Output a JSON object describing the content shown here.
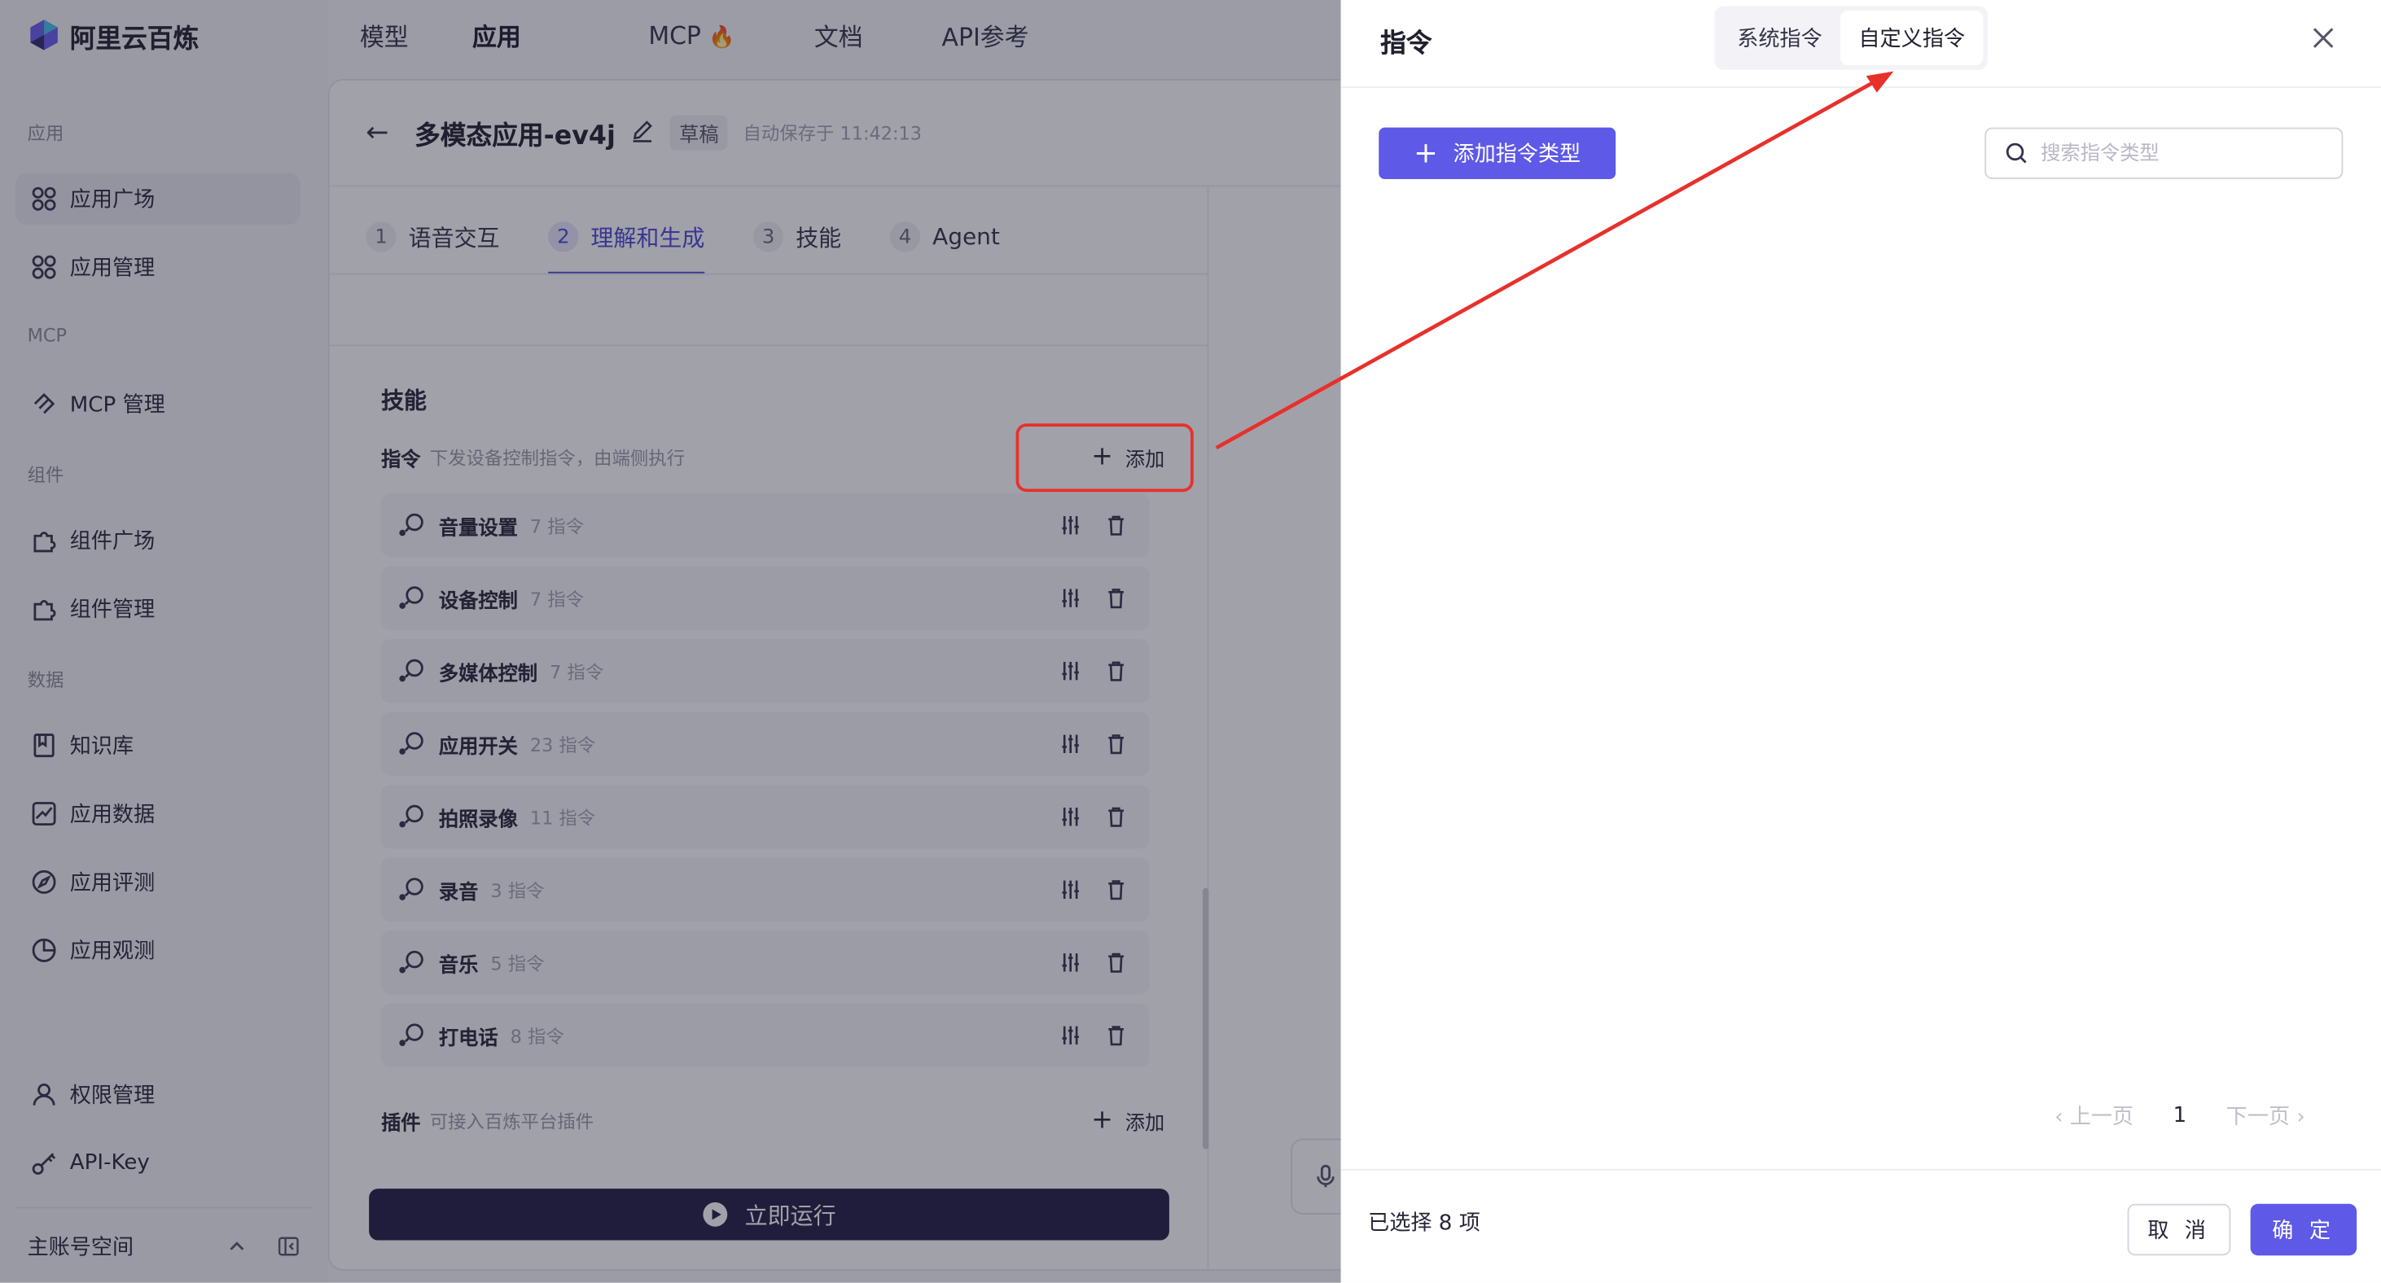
{
  "brand": {
    "name": "阿里云百炼"
  },
  "topnav": {
    "items": [
      "模型",
      "应用",
      "MCP",
      "文档",
      "API参考"
    ],
    "mcp_badge_icon": "fire-icon"
  },
  "sidebar": {
    "sections": [
      {
        "label": "应用",
        "items": [
          "应用广场",
          "应用管理"
        ]
      },
      {
        "label": "MCP",
        "items": [
          "MCP 管理"
        ]
      },
      {
        "label": "组件",
        "items": [
          "组件广场",
          "组件管理"
        ]
      },
      {
        "label": "数据",
        "items": [
          "知识库",
          "应用数据",
          "应用评测",
          "应用观测"
        ]
      }
    ],
    "bottom_items": [
      "权限管理",
      "API-Key"
    ],
    "account": "主账号空间"
  },
  "editor": {
    "title": "多模态应用-ev4j",
    "status": "草稿",
    "autosave": "自动保存于 11:42:13",
    "steps": [
      {
        "num": "1",
        "label": "语音交互"
      },
      {
        "num": "2",
        "label": "理解和生成"
      },
      {
        "num": "3",
        "label": "技能"
      },
      {
        "num": "4",
        "label": "Agent"
      }
    ],
    "skills_title": "技能",
    "commands_label": "指令",
    "commands_desc": "下发设备控制指令，由端侧执行",
    "add_label": "添加",
    "commands": [
      {
        "name": "音量设置",
        "count": "7 指令"
      },
      {
        "name": "设备控制",
        "count": "7 指令"
      },
      {
        "name": "多媒体控制",
        "count": "7 指令"
      },
      {
        "name": "应用开关",
        "count": "23 指令"
      },
      {
        "name": "拍照录像",
        "count": "11 指令"
      },
      {
        "name": "录音",
        "count": "3 指令"
      },
      {
        "name": "音乐",
        "count": "5 指令"
      },
      {
        "name": "打电话",
        "count": "8 指令"
      }
    ],
    "plugins_label": "插件",
    "plugins_desc": "可接入百炼平台插件",
    "run_label": "立即运行"
  },
  "drawer": {
    "title": "指令",
    "tabs": [
      "系统指令",
      "自定义指令"
    ],
    "active_tab": "自定义指令",
    "add_type_label": "添加指令类型",
    "search_placeholder": "搜索指令类型",
    "pagination": {
      "prev": "上一页",
      "current": "1",
      "next": "下一页"
    },
    "selected_text": "已选择 8 项",
    "cancel_label": "取 消",
    "ok_label": "确 定"
  },
  "colors": {
    "accent": "#5e59e6",
    "annotation": "#e8302b",
    "run_button": "#1f1d42"
  }
}
